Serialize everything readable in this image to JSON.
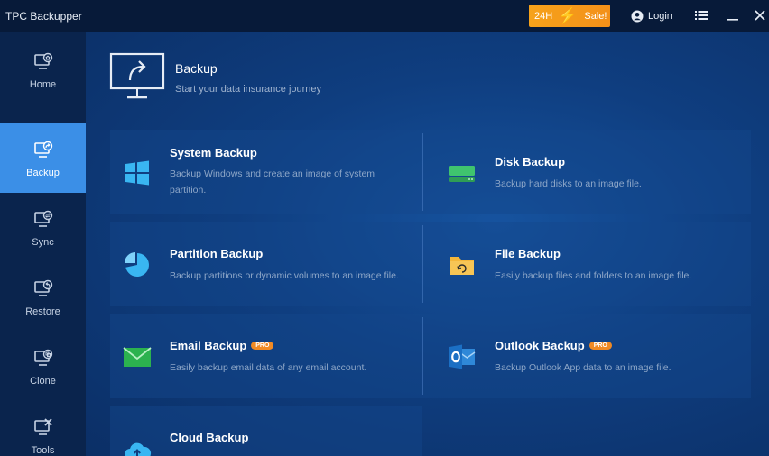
{
  "app": {
    "title": "TPC Backupper"
  },
  "promo": {
    "left": "24H",
    "right": "Sale!"
  },
  "header": {
    "login_label": "Login"
  },
  "sidebar": {
    "items": [
      {
        "label": "Home",
        "icon": "home-icon"
      },
      {
        "label": "Backup",
        "icon": "backup-icon",
        "active": true
      },
      {
        "label": "Sync",
        "icon": "sync-icon"
      },
      {
        "label": "Restore",
        "icon": "restore-icon"
      },
      {
        "label": "Clone",
        "icon": "clone-icon"
      },
      {
        "label": "Tools",
        "icon": "tools-icon"
      }
    ]
  },
  "hero": {
    "title": "Backup",
    "subtitle": "Start your data insurance journey"
  },
  "cards": [
    {
      "title": "System Backup",
      "desc": "Backup Windows and create an image of system partition.",
      "icon": "windows-icon"
    },
    {
      "title": "Disk Backup",
      "desc": "Backup hard disks to an image file.",
      "icon": "disk-icon"
    },
    {
      "title": "Partition Backup",
      "desc": "Backup partitions or dynamic volumes to an image file.",
      "icon": "pie-icon"
    },
    {
      "title": "File Backup",
      "desc": "Easily backup files and folders to an image file.",
      "icon": "folder-icon"
    },
    {
      "title": "Email Backup",
      "desc": "Easily backup email data of any email account.",
      "icon": "mail-icon",
      "badge": "PRO"
    },
    {
      "title": "Outlook Backup",
      "desc": "Backup Outlook App data to an image file.",
      "icon": "outlook-icon",
      "badge": "PRO"
    },
    {
      "title": "Cloud Backup",
      "desc": "",
      "icon": "cloud-icon"
    }
  ],
  "colors": {
    "accent": "#3b8fe7",
    "promo": "#f6a21b",
    "titlebar": "#071a39",
    "sidebar": "#0a244d"
  }
}
